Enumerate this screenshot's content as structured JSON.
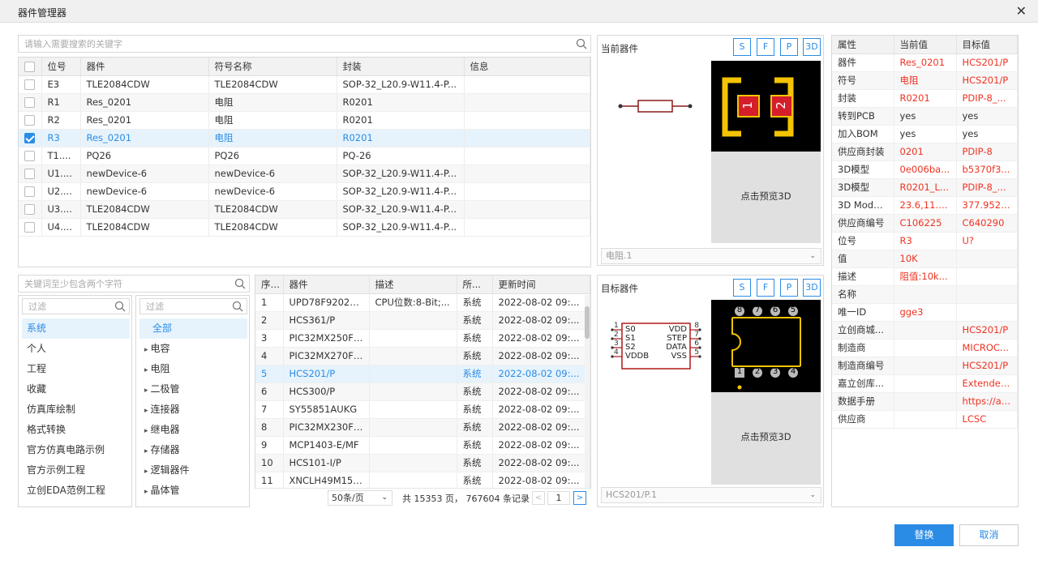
{
  "window": {
    "title": "器件管理器"
  },
  "top_search": {
    "placeholder": "请输入需要搜索的关键字"
  },
  "instance_table": {
    "headers": [
      "位号",
      "器件",
      "符号名称",
      "封装",
      "信息"
    ],
    "rows": [
      {
        "checked": false,
        "ref": "E3",
        "device": "TLE2084CDW",
        "symbol": "TLE2084CDW",
        "footprint": "SOP-32_L20.9-W11.4-P...",
        "info": ""
      },
      {
        "checked": false,
        "ref": "R1",
        "device": "Res_0201",
        "symbol": "电阻",
        "footprint": "R0201",
        "info": ""
      },
      {
        "checked": false,
        "ref": "R2",
        "device": "Res_0201",
        "symbol": "电阻",
        "footprint": "R0201",
        "info": ""
      },
      {
        "checked": true,
        "ref": "R3",
        "device": "Res_0201",
        "symbol": "电阻",
        "footprint": "R0201",
        "info": ""
      },
      {
        "checked": false,
        "ref": "T1....",
        "device": "PQ26",
        "symbol": "PQ26",
        "footprint": "PQ-26",
        "info": ""
      },
      {
        "checked": false,
        "ref": "U1....",
        "device": "newDevice-6",
        "symbol": "newDevice-6",
        "footprint": "SOP-32_L20.9-W11.4-P...",
        "info": ""
      },
      {
        "checked": false,
        "ref": "U2....",
        "device": "newDevice-6",
        "symbol": "newDevice-6",
        "footprint": "SOP-32_L20.9-W11.4-P...",
        "info": ""
      },
      {
        "checked": false,
        "ref": "U3....",
        "device": "TLE2084CDW",
        "symbol": "TLE2084CDW",
        "footprint": "SOP-32_L20.9-W11.4-P...",
        "info": ""
      },
      {
        "checked": false,
        "ref": "U4....",
        "device": "TLE2084CDW",
        "symbol": "TLE2084CDW",
        "footprint": "SOP-32_L20.9-W11.4-P...",
        "info": ""
      }
    ]
  },
  "lib_search": {
    "placeholder": "关键词至少包含两个字符"
  },
  "category_filter": {
    "placeholder": "过滤"
  },
  "categories": [
    "系统",
    "个人",
    "工程",
    "收藏",
    "仿真库绘制",
    "格式转换",
    "官方仿真电路示例",
    "官方示例工程",
    "立创EDA范例工程"
  ],
  "type_filter": {
    "placeholder": "过滤"
  },
  "types": [
    "全部",
    "电容",
    "电阻",
    "二极管",
    "连接器",
    "继电器",
    "存储器",
    "逻辑器件",
    "晶体管"
  ],
  "results_table": {
    "headers": [
      "序号",
      "器件",
      "描述",
      "所...",
      "更新时间"
    ],
    "rows": [
      {
        "no": "1",
        "device": "UPD78F9202M...",
        "desc": "CPU位数:8-Bit;...",
        "owner": "系统",
        "time": "2022-08-02 09:..."
      },
      {
        "no": "2",
        "device": "HCS361/P",
        "desc": "",
        "owner": "系统",
        "time": "2022-08-02 09:..."
      },
      {
        "no": "3",
        "device": "PIC32MX250F1...",
        "desc": "",
        "owner": "系统",
        "time": "2022-08-02 09:..."
      },
      {
        "no": "4",
        "device": "PIC32MX270F2...",
        "desc": "",
        "owner": "系统",
        "time": "2022-08-02 09:..."
      },
      {
        "no": "5",
        "device": "HCS201/P",
        "desc": "",
        "owner": "系统",
        "time": "2022-08-02 09:..."
      },
      {
        "no": "6",
        "device": "HCS300/P",
        "desc": "",
        "owner": "系统",
        "time": "2022-08-02 09:..."
      },
      {
        "no": "7",
        "device": "SY55851AUKG",
        "desc": "",
        "owner": "系统",
        "time": "2022-08-02 09:..."
      },
      {
        "no": "8",
        "device": "PIC32MX230F0...",
        "desc": "",
        "owner": "系统",
        "time": "2022-08-02 09:..."
      },
      {
        "no": "9",
        "device": "MCP1403-E/MF",
        "desc": "",
        "owner": "系统",
        "time": "2022-08-02 09:..."
      },
      {
        "no": "10",
        "device": "HCS101-I/P",
        "desc": "",
        "owner": "系统",
        "time": "2022-08-02 09:..."
      },
      {
        "no": "11",
        "device": "XNCLH49M152...",
        "desc": "",
        "owner": "系统",
        "time": "2022-08-02 09:..."
      }
    ]
  },
  "pagination": {
    "page_size": "50条/页",
    "summary": "共 15353 页， 767604 条记录",
    "page": "1",
    "prev": "<",
    "next": ">"
  },
  "current_device": {
    "title": "当前器件",
    "buttons": [
      "S",
      "F",
      "P",
      "3D"
    ],
    "preview_3d": "点击预览3D",
    "select": "电阻.1",
    "pads": [
      "1",
      "2"
    ]
  },
  "target_device": {
    "title": "目标器件",
    "buttons": [
      "S",
      "F",
      "P",
      "3D"
    ],
    "preview_3d": "点击预览3D",
    "select": "HCS201/P.1",
    "symbol": {
      "left_pins": [
        "1",
        "2",
        "3",
        "4"
      ],
      "left_labels": [
        "S0",
        "S1",
        "S2",
        "VDDB"
      ],
      "right_pins": [
        "8",
        "7",
        "6",
        "5"
      ],
      "right_labels": [
        "VDD",
        "STEP",
        "DATA",
        "VSS"
      ]
    },
    "pads_top": [
      "8",
      "7",
      "6",
      "5"
    ],
    "pads_bottom": [
      "1",
      "2",
      "3",
      "4"
    ]
  },
  "properties": {
    "headers": [
      "属性",
      "当前值",
      "目标值"
    ],
    "rows": [
      {
        "name": "器件",
        "cur": "Res_0201",
        "tgt": "HCS201/P",
        "cur_red": true,
        "tgt_red": true
      },
      {
        "name": "符号",
        "cur": "电阻",
        "tgt": "HCS201/P",
        "cur_red": true,
        "tgt_red": true
      },
      {
        "name": "封装",
        "cur": "R0201",
        "tgt": "PDIP-8_...",
        "cur_red": true,
        "tgt_red": true
      },
      {
        "name": "转到PCB",
        "cur": "yes",
        "tgt": "yes",
        "cur_red": false,
        "tgt_red": false
      },
      {
        "name": "加入BOM",
        "cur": "yes",
        "tgt": "yes",
        "cur_red": false,
        "tgt_red": false
      },
      {
        "name": "供应商封装",
        "cur": "0201",
        "tgt": "PDIP-8",
        "cur_red": true,
        "tgt_red": true
      },
      {
        "name": "3D模型",
        "cur": "0e006ba...",
        "tgt": "b5370f3...",
        "cur_red": true,
        "tgt_red": true
      },
      {
        "name": "3D模型",
        "cur": "R0201_L...",
        "tgt": "PDIP-8_...",
        "cur_red": true,
        "tgt_red": true
      },
      {
        "name": "3D Mode...",
        "cur": "23.6,11.8...",
        "tgt": "377.952,...",
        "cur_red": true,
        "tgt_red": true
      },
      {
        "name": "供应商编号",
        "cur": "C106225",
        "tgt": "C640290",
        "cur_red": true,
        "tgt_red": true
      },
      {
        "name": "位号",
        "cur": "R3",
        "tgt": "U?",
        "cur_red": true,
        "tgt_red": true
      },
      {
        "name": "值",
        "cur": "10K",
        "tgt": "",
        "cur_red": true,
        "tgt_red": false
      },
      {
        "name": "描述",
        "cur": "阻值:10k...",
        "tgt": "",
        "cur_red": true,
        "tgt_red": false
      },
      {
        "name": "名称",
        "cur": "",
        "tgt": "",
        "cur_red": false,
        "tgt_red": false
      },
      {
        "name": "唯一ID",
        "cur": "gge3",
        "tgt": "",
        "cur_red": true,
        "tgt_red": false
      },
      {
        "name": "立创商城...",
        "cur": "",
        "tgt": "HCS201/P",
        "cur_red": false,
        "tgt_red": true
      },
      {
        "name": "制造商",
        "cur": "",
        "tgt": "MICROC...",
        "cur_red": false,
        "tgt_red": true
      },
      {
        "name": "制造商编号",
        "cur": "",
        "tgt": "HCS201/P",
        "cur_red": false,
        "tgt_red": true
      },
      {
        "name": "嘉立创库...",
        "cur": "",
        "tgt": "Extended...",
        "cur_red": false,
        "tgt_red": true
      },
      {
        "name": "数据手册",
        "cur": "",
        "tgt": "https://att...",
        "cur_red": false,
        "tgt_red": true
      },
      {
        "name": "供应商",
        "cur": "",
        "tgt": "LCSC",
        "cur_red": false,
        "tgt_red": true
      }
    ]
  },
  "actions": {
    "replace": "替换",
    "cancel": "取消"
  },
  "colors": {
    "accent": "#2b8ce6",
    "red": "#e32222",
    "pcb_bg": "#000000",
    "pad_yellow": "#f5c400",
    "pad_red": "#d41f2b"
  }
}
